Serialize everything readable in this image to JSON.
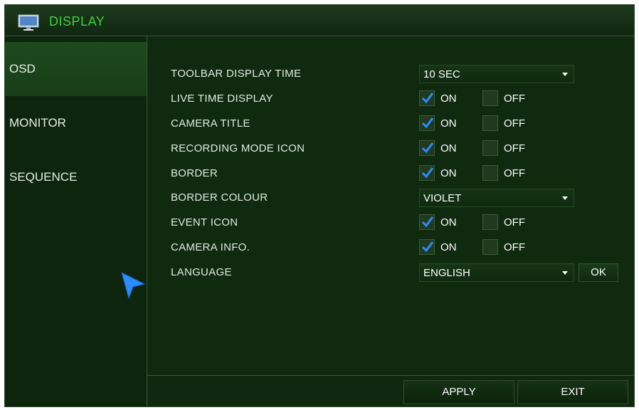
{
  "window": {
    "title": "DISPLAY",
    "icon": "monitor-icon"
  },
  "sidebar": {
    "items": [
      {
        "label": "OSD",
        "active": true
      },
      {
        "label": "MONITOR",
        "active": false
      },
      {
        "label": "SEQUENCE",
        "active": false
      }
    ]
  },
  "settings": {
    "toolbar_display_time": {
      "label": "TOOLBAR DISPLAY TIME",
      "value": "10 SEC"
    },
    "live_time_display": {
      "label": "LIVE TIME DISPLAY",
      "on_label": "ON",
      "off_label": "OFF",
      "on_checked": true,
      "off_checked": false
    },
    "camera_title": {
      "label": "CAMERA TITLE",
      "on_label": "ON",
      "off_label": "OFF",
      "on_checked": true,
      "off_checked": false
    },
    "recording_mode_icon": {
      "label": "RECORDING MODE ICON",
      "on_label": "ON",
      "off_label": "OFF",
      "on_checked": true,
      "off_checked": false
    },
    "border": {
      "label": "BORDER",
      "on_label": "ON",
      "off_label": "OFF",
      "on_checked": true,
      "off_checked": false
    },
    "border_colour": {
      "label": "BORDER COLOUR",
      "value": "VIOLET"
    },
    "event_icon": {
      "label": "EVENT ICON",
      "on_label": "ON",
      "off_label": "OFF",
      "on_checked": true,
      "off_checked": false
    },
    "camera_info": {
      "label": "CAMERA INFO.",
      "on_label": "ON",
      "off_label": "OFF",
      "on_checked": true,
      "off_checked": false
    },
    "language": {
      "label": "LANGUAGE",
      "value": "ENGLISH",
      "ok_label": "OK"
    }
  },
  "footer": {
    "apply_label": "APPLY",
    "exit_label": "EXIT"
  },
  "colors": {
    "accent": "#3ed23e",
    "check": "#2e8bff",
    "background": "#0f2a0f"
  }
}
